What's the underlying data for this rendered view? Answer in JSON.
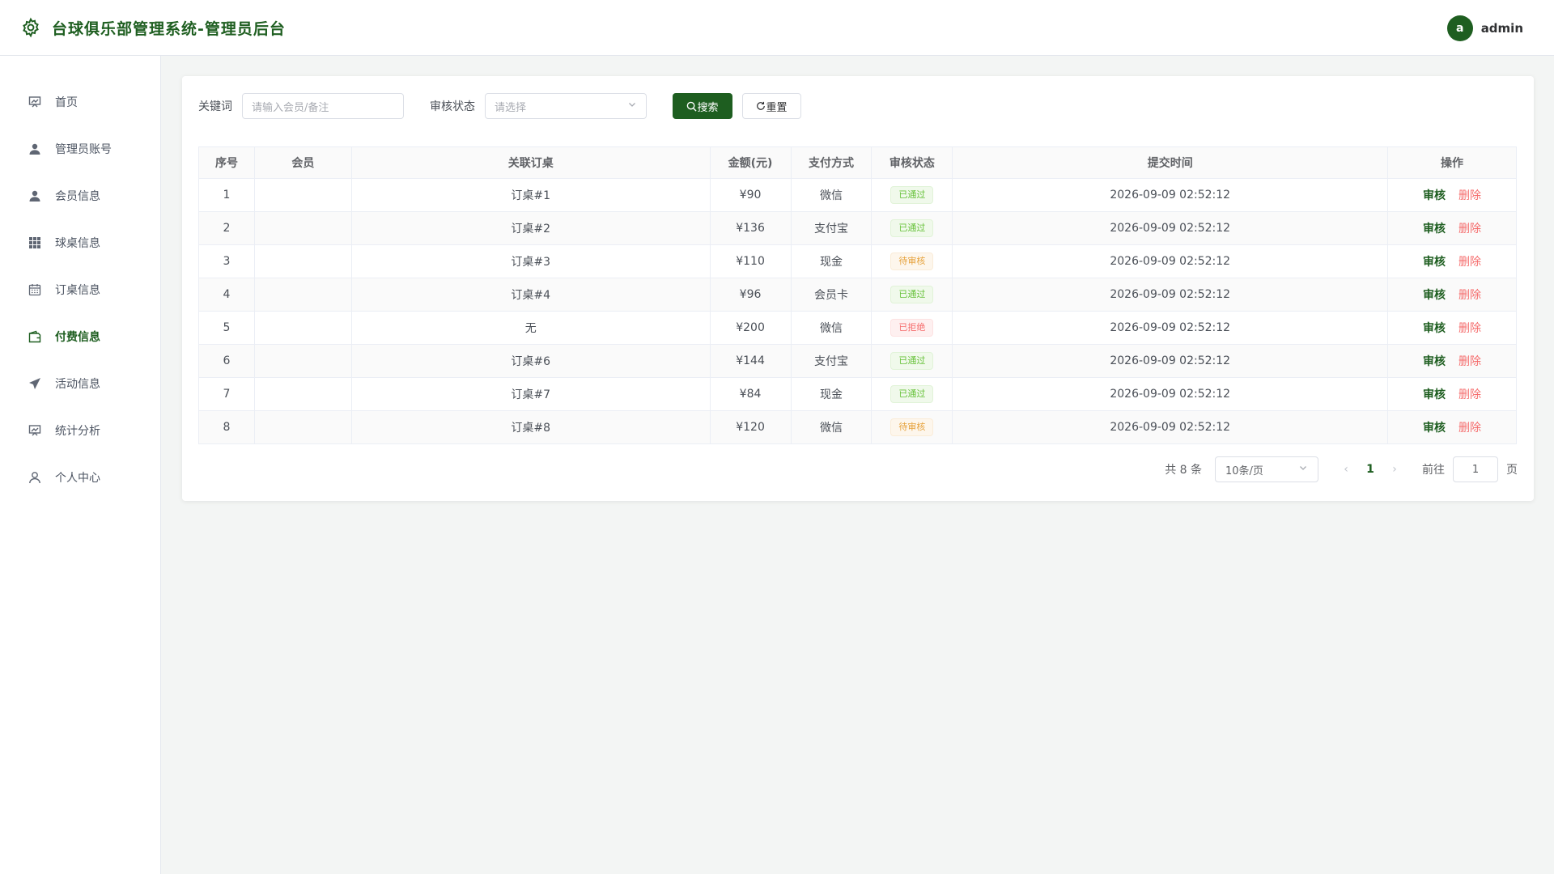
{
  "app": {
    "title": "台球俱乐部管理系统-管理员后台"
  },
  "user": {
    "avatar_letter": "a",
    "name": "admin"
  },
  "sidebar": {
    "items": [
      {
        "label": "首页",
        "icon": "dashboard-icon"
      },
      {
        "label": "管理员账号",
        "icon": "user-icon"
      },
      {
        "label": "会员信息",
        "icon": "member-icon"
      },
      {
        "label": "球桌信息",
        "icon": "grid-icon"
      },
      {
        "label": "订桌信息",
        "icon": "calendar-icon"
      },
      {
        "label": "付费信息",
        "icon": "wallet-icon"
      },
      {
        "label": "活动信息",
        "icon": "send-icon"
      },
      {
        "label": "统计分析",
        "icon": "chart-icon"
      },
      {
        "label": "个人中心",
        "icon": "person-icon"
      }
    ]
  },
  "filter": {
    "keyword_label": "关键词",
    "keyword_placeholder": "请输入会员/备注",
    "status_label": "审核状态",
    "status_placeholder": "请选择",
    "search_label": "搜索",
    "reset_label": "重置"
  },
  "table": {
    "headers": [
      "序号",
      "会员",
      "关联订桌",
      "金额(元)",
      "支付方式",
      "审核状态",
      "提交时间",
      "操作"
    ],
    "rows": [
      {
        "no": "1",
        "member": "",
        "order": "订桌#1",
        "amount": "¥90",
        "pay": "微信",
        "status": "已通过",
        "status_type": "success",
        "time": "2026-09-09 02:52:12"
      },
      {
        "no": "2",
        "member": "",
        "order": "订桌#2",
        "amount": "¥136",
        "pay": "支付宝",
        "status": "已通过",
        "status_type": "success",
        "time": "2026-09-09 02:52:12"
      },
      {
        "no": "3",
        "member": "",
        "order": "订桌#3",
        "amount": "¥110",
        "pay": "现金",
        "status": "待审核",
        "status_type": "warning",
        "time": "2026-09-09 02:52:12"
      },
      {
        "no": "4",
        "member": "",
        "order": "订桌#4",
        "amount": "¥96",
        "pay": "会员卡",
        "status": "已通过",
        "status_type": "success",
        "time": "2026-09-09 02:52:12"
      },
      {
        "no": "5",
        "member": "",
        "order": "无",
        "amount": "¥200",
        "pay": "微信",
        "status": "已拒绝",
        "status_type": "danger",
        "time": "2026-09-09 02:52:12"
      },
      {
        "no": "6",
        "member": "",
        "order": "订桌#6",
        "amount": "¥144",
        "pay": "支付宝",
        "status": "已通过",
        "status_type": "success",
        "time": "2026-09-09 02:52:12"
      },
      {
        "no": "7",
        "member": "",
        "order": "订桌#7",
        "amount": "¥84",
        "pay": "现金",
        "status": "已通过",
        "status_type": "success",
        "time": "2026-09-09 02:52:12"
      },
      {
        "no": "8",
        "member": "",
        "order": "订桌#8",
        "amount": "¥120",
        "pay": "微信",
        "status": "待审核",
        "status_type": "warning",
        "time": "2026-09-09 02:52:12"
      }
    ],
    "audit_label": "审核",
    "delete_label": "删除"
  },
  "pagination": {
    "total_text": "共 8 条",
    "page_size": "10条/页",
    "current_page": "1",
    "goto_label": "前往",
    "goto_value": "1",
    "page_suffix": "页"
  },
  "colors": {
    "primary": "#1e5e20",
    "success": "#67c23a",
    "warning": "#e6a23c",
    "danger": "#f56c6c"
  }
}
